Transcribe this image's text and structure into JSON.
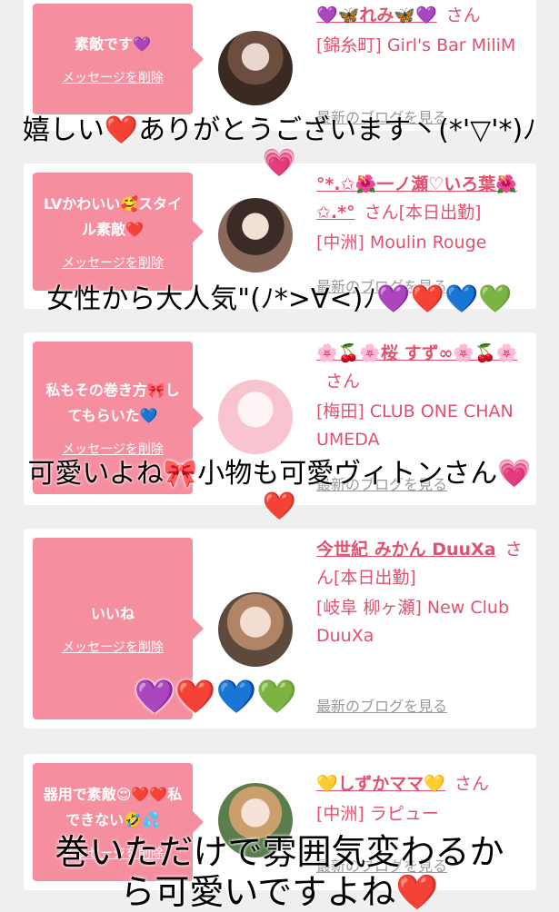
{
  "cards": [
    {
      "message": "素敵です💜",
      "delete_label": "メッセージを削除",
      "name": "💜🦋れみ🦋💜",
      "san": "さん",
      "shop": "[錦糸町] Girl's Bar MiliM",
      "blog": "最新のブログを見る"
    },
    {
      "message": "LVかわいい🥰スタイル素敵❤️",
      "delete_label": "メッセージを削除",
      "name": "°*.✩🌺一ノ瀬♡いろ葉🌺✩.*°",
      "san": "さん[本日出勤]",
      "shop": "[中洲] Moulin Rouge",
      "blog": "最新のブログを見る"
    },
    {
      "message": "私もその巻き方🎀してもらいた💙",
      "delete_label": "メッセージを削除",
      "name": "🌸🍒🌸桜 すず∞🌸🍒🌸",
      "san": "さん",
      "shop": "[梅田] CLUB ONE CHAN UMEDA",
      "blog": "最新のブログを見る"
    },
    {
      "message": "いいね",
      "delete_label": "メッセージを削除",
      "name": "今世紀 みかん DuuXa",
      "san": "さん[本日出勤]",
      "shop": "[岐阜 柳ヶ瀬] New Club DuuXa",
      "blog": "最新のブログを見る"
    },
    {
      "message": "器用で素敵😍❤️❤️私できない🤣💦",
      "delete_label": "メッセージを削除",
      "name": "💛しずかママ💛",
      "san": "さん",
      "shop": "[中洲] ラピュー",
      "blog": "最新のブログを見る"
    }
  ],
  "overlays": {
    "caption1": "嬉しい❤️ありがとうございます丶(*'▽'*)ﾉ",
    "caption1_heart": "💗",
    "caption2": "女性から大人気\"(ﾉ*>∀<)ﾉ💜❤️💙💚",
    "caption3": "可愛いよね🎀小物も可愛ヴィトンさん💗",
    "caption3_heart": "❤️",
    "caption4": "💜❤️💙💚",
    "caption5_line1": "巻いただけで雰囲気変わるか",
    "caption5_line2": "ら可愛いですよね❤️"
  },
  "colors": {
    "bubble": "#f58fa0",
    "name": "#e1516f",
    "background": "#efefef"
  }
}
